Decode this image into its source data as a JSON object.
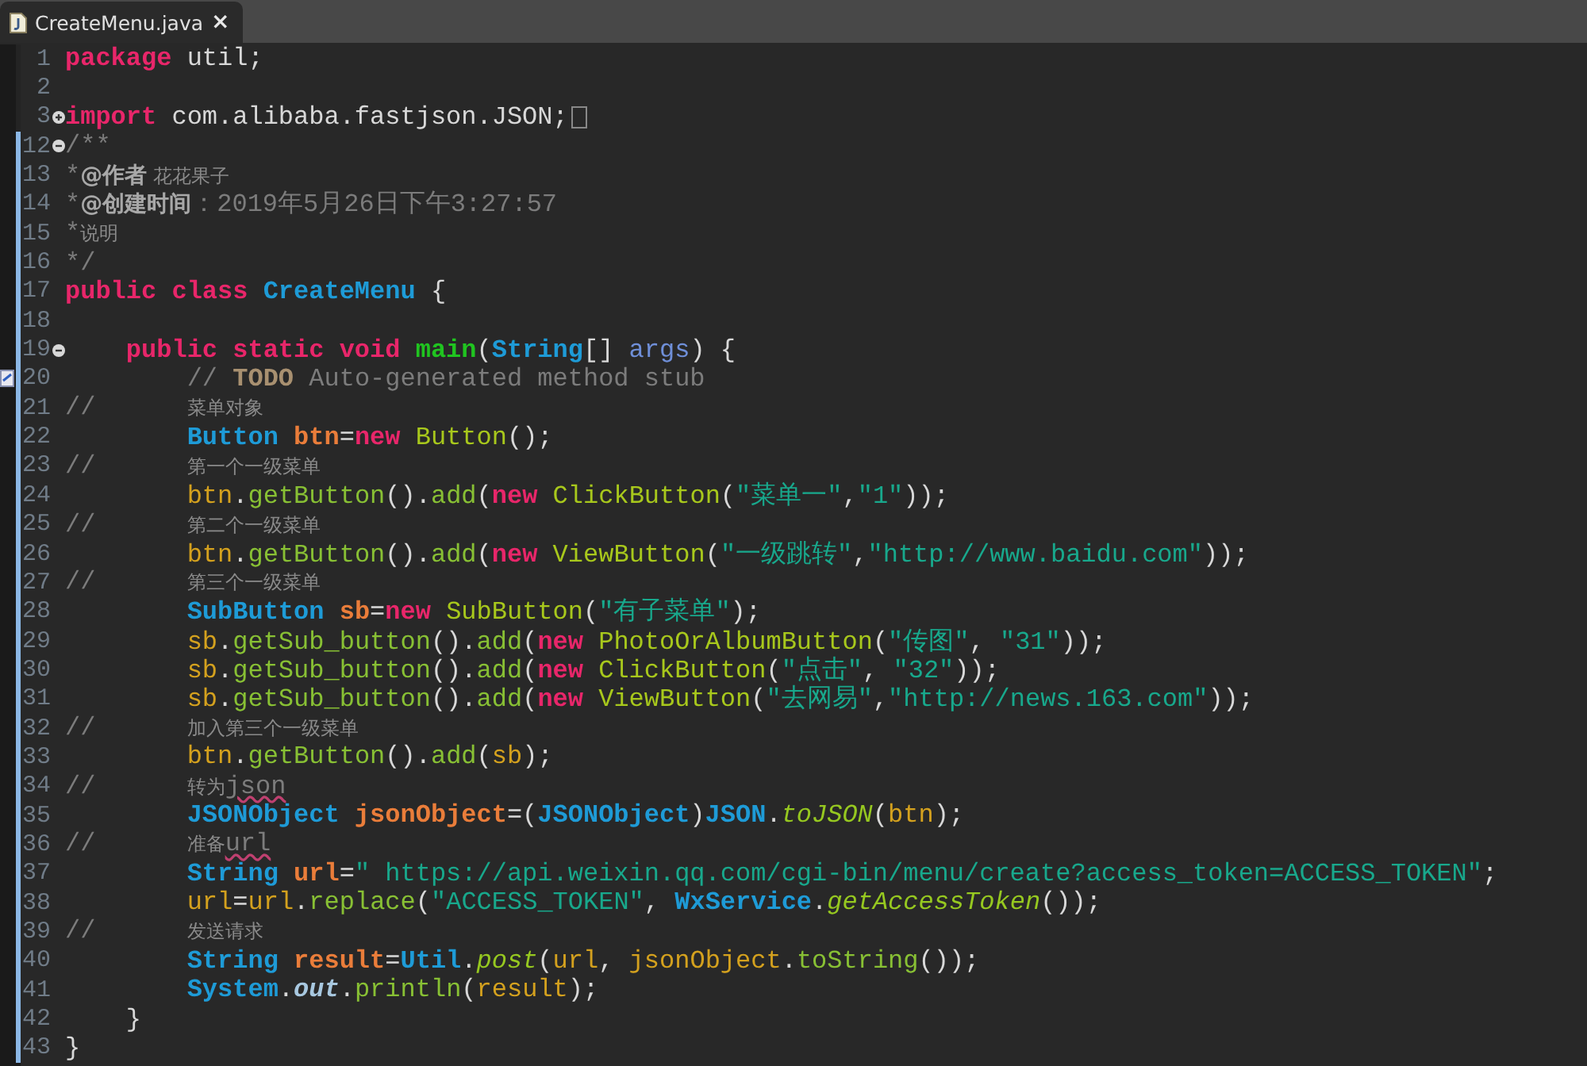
{
  "tabs": [
    {
      "label": "CreateMenu.java",
      "selected": true,
      "close": "×"
    }
  ],
  "lines": [
    {
      "number": "1",
      "changed": false,
      "tokens": [
        {
          "kind": "kw",
          "text": "package"
        },
        {
          "kind": "plain",
          "text": " util;"
        }
      ]
    },
    {
      "number": "2",
      "changed": false
    },
    {
      "number": "3",
      "changed": false,
      "expanded": false,
      "tokens": [
        {
          "kind": "kw",
          "text": "import"
        },
        {
          "kind": "plain",
          "text": " com.alibaba.fastjson.JSON;"
        }
      ]
    },
    {
      "number": "12",
      "changed": true,
      "expanded": true,
      "tokens": [
        {
          "kind": "comment",
          "text": "/**"
        }
      ]
    },
    {
      "number": "13",
      "changed": true,
      "tokens": [
        {
          "kind": "comment",
          "text": "*"
        },
        {
          "kind": "doctag",
          "text": "@作者"
        },
        {
          "kind": "cjk",
          "text": " 花花果子"
        }
      ]
    },
    {
      "number": "14",
      "changed": true,
      "tokens": [
        {
          "kind": "comment",
          "text": "*"
        },
        {
          "kind": "doctag",
          "text": "@创建时间"
        },
        {
          "kind": "comment",
          "text": "：2019年5月26日下午3:27:57"
        }
      ]
    },
    {
      "number": "15",
      "changed": true,
      "tokens": [
        {
          "kind": "comment",
          "text": "*"
        },
        {
          "kind": "cjk",
          "text": "说明"
        }
      ]
    },
    {
      "number": "16",
      "changed": true,
      "tokens": [
        {
          "kind": "comment",
          "text": "*/"
        }
      ]
    },
    {
      "number": "17",
      "changed": true,
      "tokens": [
        {
          "kind": "kw",
          "text": "public class"
        },
        {
          "kind": "type",
          "text": " CreateMenu"
        },
        {
          "kind": "plain",
          "text": " {"
        }
      ]
    },
    {
      "number": "18",
      "changed": true
    },
    {
      "number": "19",
      "changed": true,
      "expanded": true,
      "tokens": [
        {
          "kind": "kw",
          "text": "    public static void"
        },
        {
          "kind": "main",
          "text": " main"
        },
        {
          "kind": "plain",
          "text": "("
        },
        {
          "kind": "type",
          "text": "String"
        },
        {
          "kind": "plain",
          "text": "[] "
        },
        {
          "kind": "param",
          "text": "args"
        },
        {
          "kind": "plain",
          "text": ") {"
        }
      ]
    },
    {
      "number": "20",
      "changed": true,
      "task": true,
      "tokens": [
        {
          "kind": "comment",
          "text": "        // "
        },
        {
          "kind": "todo",
          "text": "TODO"
        },
        {
          "kind": "comment",
          "text": " Auto-generated method stub"
        }
      ]
    },
    {
      "number": "21",
      "changed": true,
      "tokens": [
        {
          "kind": "comment",
          "text": "//      "
        },
        {
          "kind": "cjk",
          "text": "菜单对象"
        }
      ]
    },
    {
      "number": "22",
      "changed": true,
      "tokens": [
        {
          "kind": "type",
          "text": "        Button"
        },
        {
          "kind": "decl",
          "text": " btn"
        },
        {
          "kind": "plain",
          "text": "="
        },
        {
          "kind": "kw",
          "text": "new"
        },
        {
          "kind": "ctor",
          "text": " Button"
        },
        {
          "kind": "plain",
          "text": "();"
        }
      ]
    },
    {
      "number": "23",
      "changed": true,
      "tokens": [
        {
          "kind": "comment",
          "text": "//      "
        },
        {
          "kind": "cjk",
          "text": "第一个一级菜单"
        }
      ]
    },
    {
      "number": "24",
      "changed": true,
      "tokens": [
        {
          "kind": "var",
          "text": "        btn"
        },
        {
          "kind": "plain",
          "text": "."
        },
        {
          "kind": "method",
          "text": "getButton"
        },
        {
          "kind": "plain",
          "text": "()."
        },
        {
          "kind": "method",
          "text": "add"
        },
        {
          "kind": "plain",
          "text": "("
        },
        {
          "kind": "kw",
          "text": "new"
        },
        {
          "kind": "ctor",
          "text": " ClickButton"
        },
        {
          "kind": "plain",
          "text": "("
        },
        {
          "kind": "str",
          "text": "\"菜单一\""
        },
        {
          "kind": "plain",
          "text": ","
        },
        {
          "kind": "str",
          "text": "\"1\""
        },
        {
          "kind": "plain",
          "text": "));"
        }
      ]
    },
    {
      "number": "25",
      "changed": true,
      "tokens": [
        {
          "kind": "comment",
          "text": "//      "
        },
        {
          "kind": "cjk",
          "text": "第二个一级菜单"
        }
      ]
    },
    {
      "number": "26",
      "changed": true,
      "tokens": [
        {
          "kind": "var",
          "text": "        btn"
        },
        {
          "kind": "plain",
          "text": "."
        },
        {
          "kind": "method",
          "text": "getButton"
        },
        {
          "kind": "plain",
          "text": "()."
        },
        {
          "kind": "method",
          "text": "add"
        },
        {
          "kind": "plain",
          "text": "("
        },
        {
          "kind": "kw",
          "text": "new"
        },
        {
          "kind": "ctor",
          "text": " ViewButton"
        },
        {
          "kind": "plain",
          "text": "("
        },
        {
          "kind": "str",
          "text": "\"一级跳转\""
        },
        {
          "kind": "plain",
          "text": ","
        },
        {
          "kind": "str",
          "text": "\"http://www.baidu.com\""
        },
        {
          "kind": "plain",
          "text": "));"
        }
      ]
    },
    {
      "number": "27",
      "changed": true,
      "tokens": [
        {
          "kind": "comment",
          "text": "//      "
        },
        {
          "kind": "cjk",
          "text": "第三个一级菜单"
        }
      ]
    },
    {
      "number": "28",
      "changed": true,
      "tokens": [
        {
          "kind": "type",
          "text": "        SubButton"
        },
        {
          "kind": "decl",
          "text": " sb"
        },
        {
          "kind": "plain",
          "text": "="
        },
        {
          "kind": "kw",
          "text": "new"
        },
        {
          "kind": "ctor",
          "text": " SubButton"
        },
        {
          "kind": "plain",
          "text": "("
        },
        {
          "kind": "str",
          "text": "\"有子菜单\""
        },
        {
          "kind": "plain",
          "text": ");"
        }
      ]
    },
    {
      "number": "29",
      "changed": true,
      "tokens": [
        {
          "kind": "var",
          "text": "        sb"
        },
        {
          "kind": "plain",
          "text": "."
        },
        {
          "kind": "method",
          "text": "getSub_button"
        },
        {
          "kind": "plain",
          "text": "()."
        },
        {
          "kind": "method",
          "text": "add"
        },
        {
          "kind": "plain",
          "text": "("
        },
        {
          "kind": "kw",
          "text": "new"
        },
        {
          "kind": "ctor",
          "text": " PhotoOrAlbumButton"
        },
        {
          "kind": "plain",
          "text": "("
        },
        {
          "kind": "str",
          "text": "\"传图\""
        },
        {
          "kind": "plain",
          "text": ","
        },
        {
          "kind": "str",
          "text": " \"31\""
        },
        {
          "kind": "plain",
          "text": "));"
        }
      ]
    },
    {
      "number": "30",
      "changed": true,
      "tokens": [
        {
          "kind": "var",
          "text": "        sb"
        },
        {
          "kind": "plain",
          "text": "."
        },
        {
          "kind": "method",
          "text": "getSub_button"
        },
        {
          "kind": "plain",
          "text": "()."
        },
        {
          "kind": "method",
          "text": "add"
        },
        {
          "kind": "plain",
          "text": "("
        },
        {
          "kind": "kw",
          "text": "new"
        },
        {
          "kind": "ctor",
          "text": " ClickButton"
        },
        {
          "kind": "plain",
          "text": "("
        },
        {
          "kind": "str",
          "text": "\"点击\""
        },
        {
          "kind": "plain",
          "text": ","
        },
        {
          "kind": "str",
          "text": " \"32\""
        },
        {
          "kind": "plain",
          "text": "));"
        }
      ]
    },
    {
      "number": "31",
      "changed": true,
      "tokens": [
        {
          "kind": "var",
          "text": "        sb"
        },
        {
          "kind": "plain",
          "text": "."
        },
        {
          "kind": "method",
          "text": "getSub_button"
        },
        {
          "kind": "plain",
          "text": "()."
        },
        {
          "kind": "method",
          "text": "add"
        },
        {
          "kind": "plain",
          "text": "("
        },
        {
          "kind": "kw",
          "text": "new"
        },
        {
          "kind": "ctor",
          "text": " ViewButton"
        },
        {
          "kind": "plain",
          "text": "("
        },
        {
          "kind": "str",
          "text": "\"去网易\""
        },
        {
          "kind": "plain",
          "text": ","
        },
        {
          "kind": "str",
          "text": "\"http://news.163.com\""
        },
        {
          "kind": "plain",
          "text": "));"
        }
      ]
    },
    {
      "number": "32",
      "changed": true,
      "tokens": [
        {
          "kind": "comment",
          "text": "//      "
        },
        {
          "kind": "cjk",
          "text": "加入第三个一级菜单"
        }
      ]
    },
    {
      "number": "33",
      "changed": true,
      "tokens": [
        {
          "kind": "var",
          "text": "        btn"
        },
        {
          "kind": "plain",
          "text": "."
        },
        {
          "kind": "method",
          "text": "getButton"
        },
        {
          "kind": "plain",
          "text": "()."
        },
        {
          "kind": "method",
          "text": "add"
        },
        {
          "kind": "plain",
          "text": "("
        },
        {
          "kind": "var",
          "text": "sb"
        },
        {
          "kind": "plain",
          "text": ");"
        }
      ]
    },
    {
      "number": "34",
      "changed": true,
      "tokens": [
        {
          "kind": "comment",
          "text": "//      "
        },
        {
          "kind": "cjk",
          "text": "转为"
        },
        {
          "kind": "spell",
          "text": "json"
        }
      ]
    },
    {
      "number": "35",
      "changed": true,
      "tokens": [
        {
          "kind": "type",
          "text": "        JSONObject"
        },
        {
          "kind": "decl",
          "text": " jsonObject"
        },
        {
          "kind": "plain",
          "text": "=("
        },
        {
          "kind": "type",
          "text": "JSONObject"
        },
        {
          "kind": "plain",
          "text": ")"
        },
        {
          "kind": "type",
          "text": "JSON"
        },
        {
          "kind": "plain",
          "text": "."
        },
        {
          "kind": "smethod",
          "text": "toJSON"
        },
        {
          "kind": "plain",
          "text": "("
        },
        {
          "kind": "var",
          "text": "btn"
        },
        {
          "kind": "plain",
          "text": ");"
        }
      ]
    },
    {
      "number": "36",
      "changed": true,
      "tokens": [
        {
          "kind": "comment",
          "text": "//      "
        },
        {
          "kind": "cjk",
          "text": "准备"
        },
        {
          "kind": "spell",
          "text": "url"
        }
      ]
    },
    {
      "number": "37",
      "changed": true,
      "tokens": [
        {
          "kind": "type",
          "text": "        String"
        },
        {
          "kind": "decl",
          "text": " url"
        },
        {
          "kind": "plain",
          "text": "="
        },
        {
          "kind": "str",
          "text": "\" https://api.weixin.qq.com/cgi-bin/menu/create?access_token=ACCESS_TOKEN\""
        },
        {
          "kind": "plain",
          "text": ";"
        }
      ]
    },
    {
      "number": "38",
      "changed": true,
      "tokens": [
        {
          "kind": "var",
          "text": "        url"
        },
        {
          "kind": "plain",
          "text": "="
        },
        {
          "kind": "var",
          "text": "url"
        },
        {
          "kind": "plain",
          "text": "."
        },
        {
          "kind": "method",
          "text": "replace"
        },
        {
          "kind": "plain",
          "text": "("
        },
        {
          "kind": "str",
          "text": "\"ACCESS_TOKEN\""
        },
        {
          "kind": "plain",
          "text": ","
        },
        {
          "kind": "type",
          "text": " WxService"
        },
        {
          "kind": "plain",
          "text": "."
        },
        {
          "kind": "smethod",
          "text": "getAccessToken"
        },
        {
          "kind": "plain",
          "text": "());"
        }
      ]
    },
    {
      "number": "39",
      "changed": true,
      "tokens": [
        {
          "kind": "comment",
          "text": "//      "
        },
        {
          "kind": "cjk",
          "text": "发送请求"
        }
      ]
    },
    {
      "number": "40",
      "changed": true,
      "tokens": [
        {
          "kind": "type",
          "text": "        String"
        },
        {
          "kind": "decl",
          "text": " result"
        },
        {
          "kind": "plain",
          "text": "="
        },
        {
          "kind": "type",
          "text": "Util"
        },
        {
          "kind": "plain",
          "text": "."
        },
        {
          "kind": "smethod",
          "text": "post"
        },
        {
          "kind": "plain",
          "text": "("
        },
        {
          "kind": "var",
          "text": "url"
        },
        {
          "kind": "plain",
          "text": ","
        },
        {
          "kind": "var",
          "text": " jsonObject"
        },
        {
          "kind": "plain",
          "text": "."
        },
        {
          "kind": "method",
          "text": "toString"
        },
        {
          "kind": "plain",
          "text": "());"
        }
      ]
    },
    {
      "number": "41",
      "changed": true,
      "tokens": [
        {
          "kind": "type",
          "text": "        System"
        },
        {
          "kind": "plain",
          "text": "."
        },
        {
          "kind": "field",
          "text": "out"
        },
        {
          "kind": "plain",
          "text": "."
        },
        {
          "kind": "method",
          "text": "println"
        },
        {
          "kind": "plain",
          "text": "("
        },
        {
          "kind": "var",
          "text": "result"
        },
        {
          "kind": "plain",
          "text": ");"
        }
      ]
    },
    {
      "number": "42",
      "changed": true,
      "tokens": [
        {
          "kind": "plain",
          "text": "    }"
        }
      ]
    },
    {
      "number": "43",
      "changed": true,
      "tokens": [
        {
          "kind": "plain",
          "text": "}"
        }
      ]
    }
  ]
}
